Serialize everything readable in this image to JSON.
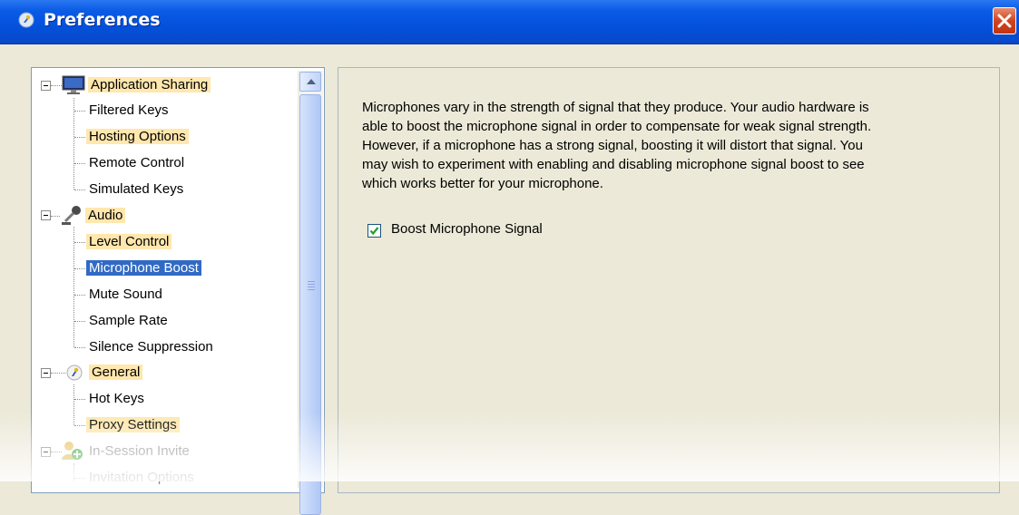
{
  "window": {
    "title": "Preferences",
    "close_icon": "close-icon",
    "accent_color": "#0451dc",
    "close_color": "#d2441e"
  },
  "tree": {
    "items": [
      {
        "label": "Application Sharing",
        "level": 0,
        "icon": "monitor-icon",
        "highlighted": true
      },
      {
        "label": "Filtered Keys",
        "level": 1
      },
      {
        "label": "Hosting Options",
        "level": 1,
        "highlighted": true
      },
      {
        "label": "Remote Control",
        "level": 1
      },
      {
        "label": "Simulated Keys",
        "level": 1
      },
      {
        "label": "Audio",
        "level": 0,
        "icon": "microphone-icon",
        "highlighted": true
      },
      {
        "label": "Level Control",
        "level": 1,
        "highlighted": true
      },
      {
        "label": "Microphone Boost",
        "level": 1,
        "selected": true
      },
      {
        "label": "Mute Sound",
        "level": 1
      },
      {
        "label": "Sample Rate",
        "level": 1
      },
      {
        "label": "Silence Suppression",
        "level": 1
      },
      {
        "label": "General",
        "level": 0,
        "icon": "app-logo-icon",
        "highlighted": true
      },
      {
        "label": "Hot Keys",
        "level": 1
      },
      {
        "label": "Proxy Settings",
        "level": 1,
        "highlighted": true
      },
      {
        "label": "In-Session Invite",
        "level": 0,
        "icon": "invite-user-icon",
        "dimmed": true
      },
      {
        "label": "Invitation Options",
        "level": 1,
        "dimmed": true
      }
    ],
    "highlight_color": "#ffe7ad",
    "selection_color": "#316ac5"
  },
  "content": {
    "description_lines": [
      "Microphones vary in the strength of signal that they produce.  Your audio hardware is",
      "able to boost the microphone signal in order to compensate for weak signal strength.",
      "However, if a microphone has a strong signal, boosting it will distort that signal.  You",
      "may wish to experiment with enabling and disabling microphone signal boost to see",
      "which works better for your microphone."
    ],
    "boost_checkbox": {
      "label": "Boost Microphone Signal",
      "checked": true
    }
  }
}
